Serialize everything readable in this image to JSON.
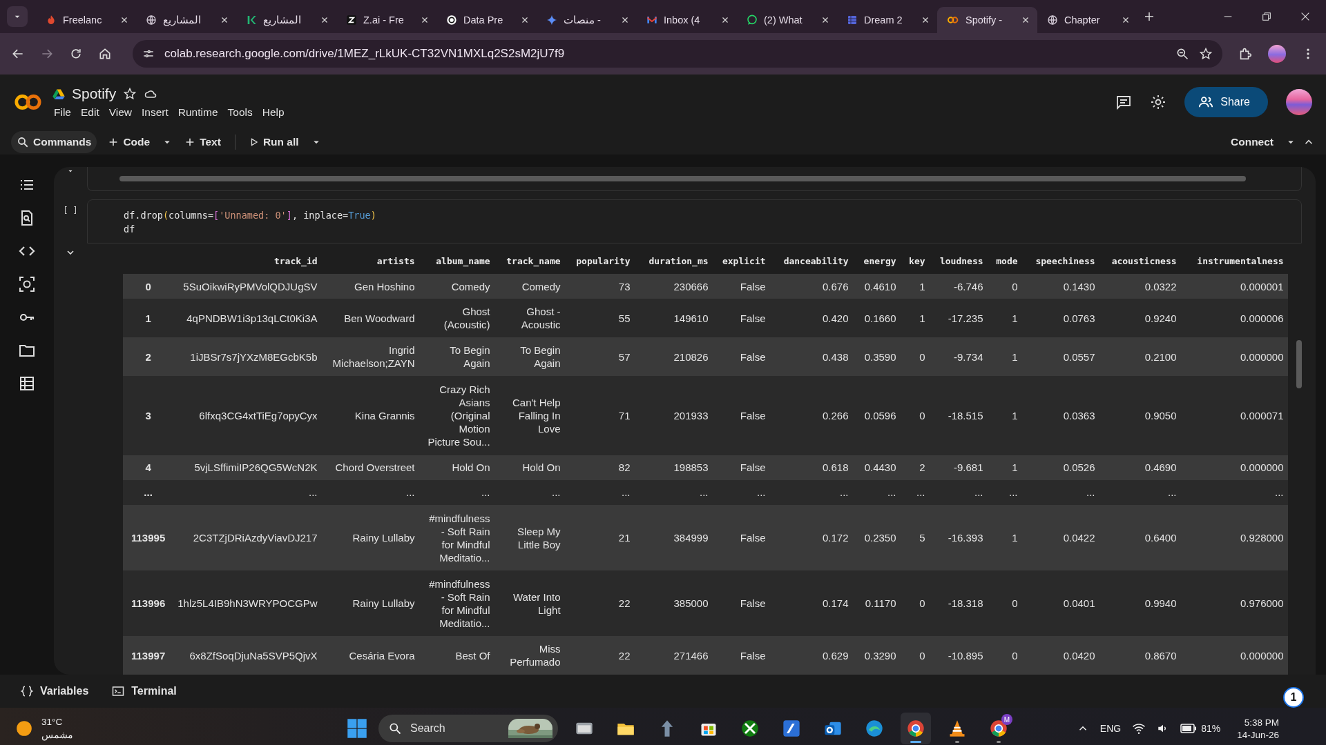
{
  "browser": {
    "tabs": [
      {
        "title": "Freelanc",
        "kind": "flame",
        "selected": false
      },
      {
        "title": "المشاريع",
        "kind": "globe",
        "selected": false
      },
      {
        "title": "المشاريع",
        "kind": "bracket",
        "selected": false
      },
      {
        "title": "Z.ai - Fre",
        "kind": "square",
        "selected": false
      },
      {
        "title": "Data Pre",
        "kind": "knot",
        "selected": false
      },
      {
        "title": "منصات -",
        "kind": "sparkle",
        "selected": false
      },
      {
        "title": "Inbox (4",
        "kind": "mail",
        "selected": false
      },
      {
        "title": "(2) What",
        "kind": "chat",
        "selected": false
      },
      {
        "title": "Dream 2",
        "kind": "grid",
        "selected": false
      },
      {
        "title": "Spotify -",
        "kind": "rings",
        "selected": true
      },
      {
        "title": "Chapter",
        "kind": "globe",
        "selected": false
      }
    ],
    "url": "colab.research.google.com/drive/1MEZ_rLkUK-CT32VN1MXLq2S2sM2jU7f9"
  },
  "notebook": {
    "title": "Spotify",
    "menu": [
      "File",
      "Edit",
      "View",
      "Insert",
      "Runtime",
      "Tools",
      "Help"
    ],
    "share_button": "Share",
    "toolbar": {
      "commands": "Commands",
      "code": "Code",
      "text": "Text",
      "run_all": "Run all",
      "connect": "Connect"
    }
  },
  "cell": {
    "run_marker": "[ ]",
    "code": [
      {
        "tokens": [
          {
            "text": "df.drop",
            "kind": "plain"
          },
          {
            "text": "(",
            "kind": "paren"
          },
          {
            "text": "columns=",
            "kind": "plain"
          },
          {
            "text": "[",
            "kind": "bracket"
          },
          {
            "text": "'Unnamed: 0'",
            "kind": "string"
          },
          {
            "text": "]",
            "kind": "bracket"
          },
          {
            "text": ", inplace=",
            "kind": "plain"
          },
          {
            "text": "True",
            "kind": "keyword"
          },
          {
            "text": ")",
            "kind": "paren"
          }
        ]
      },
      {
        "tokens": [
          {
            "text": "df",
            "kind": "plain"
          }
        ]
      }
    ]
  },
  "table": {
    "columns": [
      "track_id",
      "artists",
      "album_name",
      "track_name",
      "popularity",
      "duration_ms",
      "explicit",
      "danceability",
      "energy",
      "key",
      "loudness",
      "mode",
      "speechiness",
      "acousticness",
      "instrumentalness"
    ],
    "rows": [
      {
        "index": "0",
        "cells": [
          "5SuOikwiRyPMVolQDJUgSV",
          "Gen Hoshino",
          "Comedy",
          "Comedy",
          "73",
          "230666",
          "False",
          "0.676",
          "0.4610",
          "1",
          "-6.746",
          "0",
          "0.1430",
          "0.0322",
          "0.000001"
        ]
      },
      {
        "index": "1",
        "cells": [
          "4qPNDBW1i3p13qLCt0Ki3A",
          "Ben Woodward",
          "Ghost (Acoustic)",
          "Ghost - Acoustic",
          "55",
          "149610",
          "False",
          "0.420",
          "0.1660",
          "1",
          "-17.235",
          "1",
          "0.0763",
          "0.9240",
          "0.000006"
        ]
      },
      {
        "index": "2",
        "cells": [
          "1iJBSr7s7jYXzM8EGcbK5b",
          "Ingrid Michaelson;ZAYN",
          "To Begin Again",
          "To Begin Again",
          "57",
          "210826",
          "False",
          "0.438",
          "0.3590",
          "0",
          "-9.734",
          "1",
          "0.0557",
          "0.2100",
          "0.000000"
        ]
      },
      {
        "index": "3",
        "cells": [
          "6lfxq3CG4xtTiEg7opyCyx",
          "Kina Grannis",
          "Crazy Rich Asians (Original Motion Picture Sou...",
          "Can't Help Falling In Love",
          "71",
          "201933",
          "False",
          "0.266",
          "0.0596",
          "0",
          "-18.515",
          "1",
          "0.0363",
          "0.9050",
          "0.000071"
        ]
      },
      {
        "index": "4",
        "cells": [
          "5vjLSffimiIP26QG5WcN2K",
          "Chord Overstreet",
          "Hold On",
          "Hold On",
          "82",
          "198853",
          "False",
          "0.618",
          "0.4430",
          "2",
          "-9.681",
          "1",
          "0.0526",
          "0.4690",
          "0.000000"
        ]
      },
      {
        "index": "...",
        "cells": [
          "...",
          "...",
          "...",
          "...",
          "...",
          "...",
          "...",
          "...",
          "...",
          "...",
          "...",
          "...",
          "...",
          "...",
          "..."
        ]
      },
      {
        "index": "113995",
        "cells": [
          "2C3TZjDRiAzdyViavDJ217",
          "Rainy Lullaby",
          "#mindfulness - Soft Rain for Mindful Meditatio...",
          "Sleep My Little Boy",
          "21",
          "384999",
          "False",
          "0.172",
          "0.2350",
          "5",
          "-16.393",
          "1",
          "0.0422",
          "0.6400",
          "0.928000"
        ]
      },
      {
        "index": "113996",
        "cells": [
          "1hlz5L4IB9hN3WRYPOCGPw",
          "Rainy Lullaby",
          "#mindfulness - Soft Rain for Mindful Meditatio...",
          "Water Into Light",
          "22",
          "385000",
          "False",
          "0.174",
          "0.1170",
          "0",
          "-18.318",
          "0",
          "0.0401",
          "0.9940",
          "0.976000"
        ]
      },
      {
        "index": "113997",
        "cells": [
          "6x8ZfSoqDjuNa5SVP5QjvX",
          "Cesária Evora",
          "Best Of",
          "Miss Perfumado",
          "22",
          "271466",
          "False",
          "0.629",
          "0.3290",
          "0",
          "-10.895",
          "0",
          "0.0420",
          "0.8670",
          "0.000000"
        ]
      }
    ]
  },
  "bottom_bar": {
    "variables": "Variables",
    "terminal": "Terminal"
  },
  "taskbar": {
    "temperature": "31°C",
    "weather": "مشمس",
    "search": {
      "placeholder": "Search"
    },
    "apps": [
      {
        "kind": "window",
        "running": false,
        "selected": false
      },
      {
        "kind": "folder",
        "running": false,
        "selected": false
      },
      {
        "kind": "arrows",
        "running": false,
        "selected": false
      },
      {
        "kind": "store",
        "running": false,
        "selected": false
      },
      {
        "kind": "xbox",
        "running": false,
        "selected": false
      },
      {
        "kind": "tile",
        "running": false,
        "selected": false
      },
      {
        "kind": "mailbox",
        "running": false,
        "selected": false
      },
      {
        "kind": "wave",
        "running": false,
        "selected": false
      },
      {
        "kind": "browser",
        "running": true,
        "selected": true
      },
      {
        "kind": "cone",
        "running": true,
        "selected": false
      },
      {
        "kind": "browser",
        "running": true,
        "selected": false,
        "badge": "M"
      }
    ],
    "language": "ENG",
    "battery": "81%",
    "time": "5:38 PM",
    "date": "14-Jun-26",
    "notification_count": "1"
  }
}
